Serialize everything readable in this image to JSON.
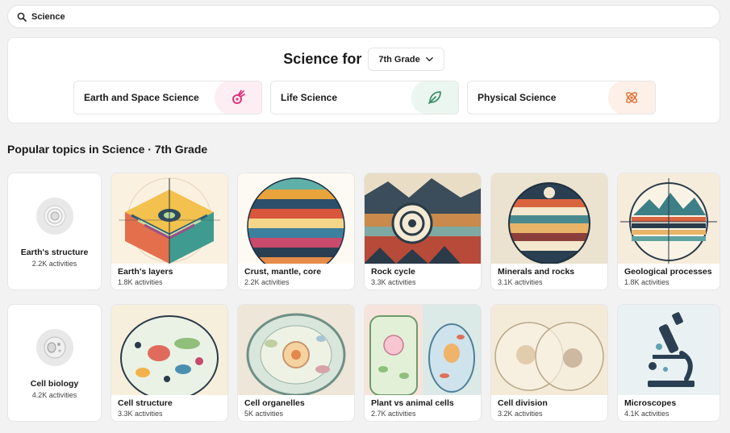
{
  "search": {
    "value": "Science"
  },
  "panel": {
    "title": "Science for",
    "grade": "7th Grade",
    "subjects": [
      {
        "label": "Earth and Space Science",
        "icon": "comet-icon",
        "color": "#e0347a",
        "bg": "#fdeef4"
      },
      {
        "label": "Life Science",
        "icon": "leaf-icon",
        "color": "#3d8f6a",
        "bg": "#ecf6f0"
      },
      {
        "label": "Physical Science",
        "icon": "atom-icon",
        "color": "#e0743a",
        "bg": "#fdf0e8"
      }
    ]
  },
  "section": {
    "title": "Popular topics in Science · 7th Grade"
  },
  "rows": [
    {
      "topic": {
        "name": "Earth's structure",
        "count": "2.2K activities"
      },
      "cards": [
        {
          "title": "Earth's layers",
          "count": "1.8K activities"
        },
        {
          "title": "Crust, mantle, core",
          "count": "2.2K activities"
        },
        {
          "title": "Rock cycle",
          "count": "3.3K activities"
        },
        {
          "title": "Minerals and rocks",
          "count": "3.1K activities"
        },
        {
          "title": "Geological processes",
          "count": "1.8K activities"
        }
      ]
    },
    {
      "topic": {
        "name": "Cell biology",
        "count": "4.2K activities"
      },
      "cards": [
        {
          "title": "Cell structure",
          "count": "3.3K activities"
        },
        {
          "title": "Cell organelles",
          "count": "5K activities"
        },
        {
          "title": "Plant vs animal cells",
          "count": "2.7K activities"
        },
        {
          "title": "Cell division",
          "count": "3.2K activities"
        },
        {
          "title": "Microscopes",
          "count": "4.1K activities"
        }
      ]
    }
  ]
}
